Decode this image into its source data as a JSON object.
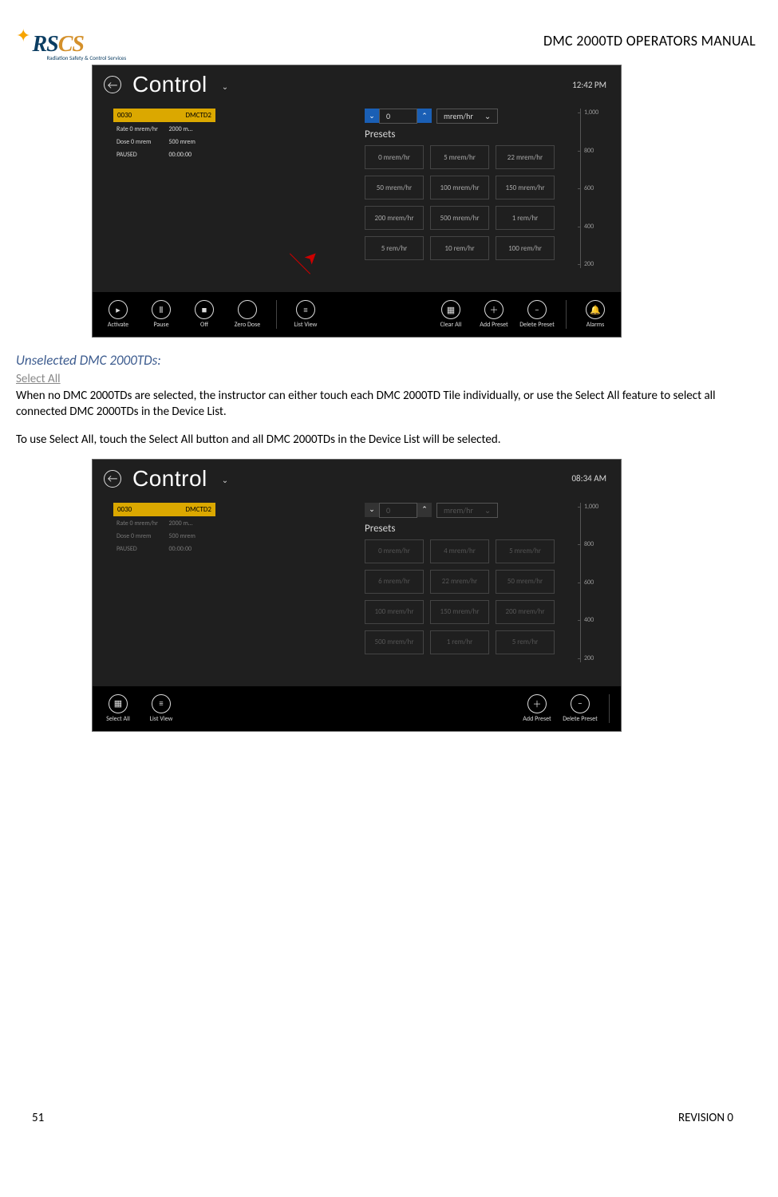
{
  "header": {
    "logo_main": "RS",
    "logo_cs": "CS",
    "logo_tag": "Radiation Safety & Control Services",
    "doc_title": "DMC 2000TD OPERATORS MANUAL"
  },
  "shot1": {
    "title": "Control",
    "clock": "12:42 PM",
    "tile": {
      "id": "0030",
      "name": "DMCTD2",
      "rate": "Rate 0 mrem/hr",
      "model": "2000 m…",
      "dose": "Dose 0 mrem",
      "val2": "500 mrem",
      "state": "PAUSED",
      "time": "00:00:00"
    },
    "spin_val": "0",
    "spin_unit": "mrem/hr",
    "presets_lbl": "Presets",
    "presets": [
      "0 mrem/hr",
      "5 mrem/hr",
      "22 mrem/hr",
      "50 mrem/hr",
      "100 mrem/hr",
      "150 mrem/hr",
      "200 mrem/hr",
      "500 mrem/hr",
      "1 rem/hr",
      "5 rem/hr",
      "10 rem/hr",
      "100 rem/hr"
    ],
    "axis": [
      "1,000",
      "800",
      "600",
      "400",
      "200"
    ],
    "bar": {
      "activate": "Activate",
      "pause": "Pause",
      "off": "Off",
      "zero": "Zero Dose",
      "list": "List View",
      "clear": "Clear All",
      "add": "Add Preset",
      "del": "Delete Preset",
      "alarm": "Alarms"
    }
  },
  "text": {
    "sec": "Unselected DMC 2000TDs:",
    "sub": "Select All",
    "p1": "When no DMC 2000TDs are selected, the instructor can either touch each DMC 2000TD Tile individually, or use the Select All feature to select all connected DMC 2000TDs in the Device List.",
    "p2": "To use Select All, touch the Select All button and all DMC 2000TDs in the Device List will be selected."
  },
  "shot2": {
    "title": "Control",
    "clock": "08:34 AM",
    "tile": {
      "id": "0030",
      "name": "DMCTD2",
      "rate": "Rate 0 mrem/hr",
      "model": "2000 m…",
      "dose": "Dose 0 mrem",
      "val2": "500 mrem",
      "state": "PAUSED",
      "time": "00:00:00"
    },
    "spin_val": "0",
    "spin_unit": "mrem/hr",
    "presets_lbl": "Presets",
    "presets": [
      "0 mrem/hr",
      "4 mrem/hr",
      "5 mrem/hr",
      "6 mrem/hr",
      "22 mrem/hr",
      "50 mrem/hr",
      "100 mrem/hr",
      "150 mrem/hr",
      "200 mrem/hr",
      "500 mrem/hr",
      "1 rem/hr",
      "5 rem/hr"
    ],
    "axis": [
      "1,000",
      "800",
      "600",
      "400",
      "200"
    ],
    "bar": {
      "select": "Select All",
      "list": "List View",
      "add": "Add Preset",
      "del": "Delete Preset"
    }
  },
  "footer": {
    "page": "51",
    "rev": "REVISION 0"
  }
}
